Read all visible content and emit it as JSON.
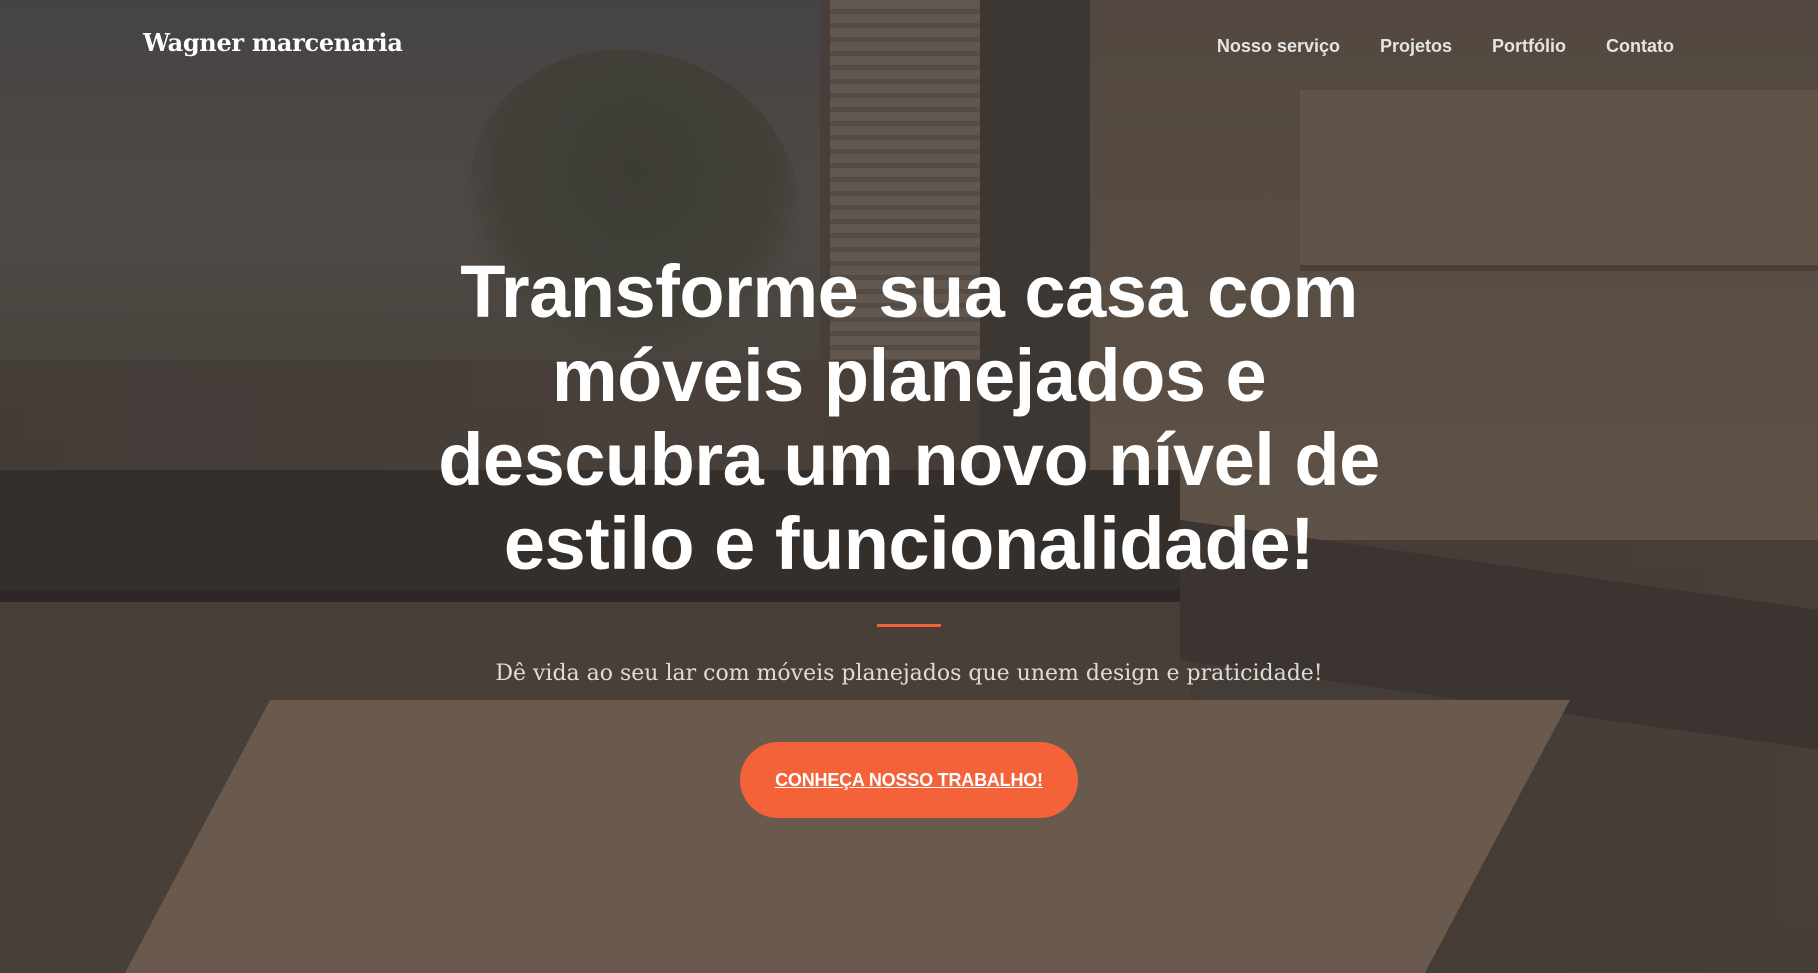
{
  "nav": {
    "brand": "Wagner marcenaria",
    "items": [
      "Nosso serviço",
      "Projetos",
      "Portfólio",
      "Contato"
    ]
  },
  "hero": {
    "headline": "Transforme sua casa com móveis planejados e descubra um novo nível de estilo e funcionalidade!",
    "subtitle": "Dê vida ao seu lar com móveis planejados que unem design e praticidade!",
    "cta": "CONHEÇA NOSSO TRABALHO!"
  },
  "colors": {
    "accent": "#f4623a",
    "text": "#ffffff"
  }
}
